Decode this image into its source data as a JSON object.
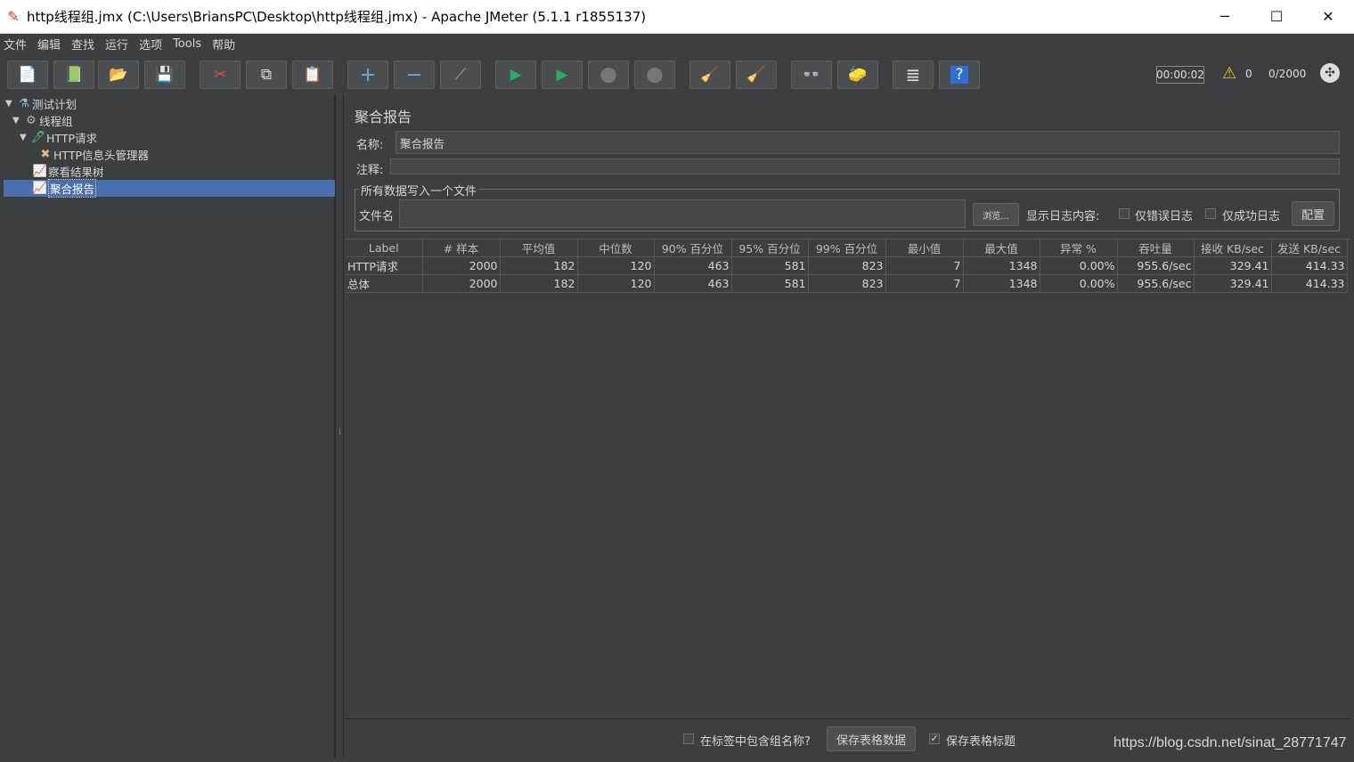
{
  "window": {
    "title": "http线程组.jmx (C:\\Users\\BriansPC\\Desktop\\http线程组.jmx) - Apache JMeter (5.1.1 r1855137)",
    "minimize": "─",
    "maximize": "☐",
    "close": "✕"
  },
  "menu": [
    "文件",
    "编辑",
    "查找",
    "运行",
    "选项",
    "Tools",
    "帮助"
  ],
  "toolbar": {
    "icons": [
      "new-icon",
      "templates-icon",
      "open-icon",
      "save-icon",
      "cut-icon",
      "copy-icon",
      "paste-icon",
      "expand-icon",
      "collapse-icon",
      "toggle-icon",
      "start-icon",
      "start-no-pause-icon",
      "stop-icon",
      "shutdown-icon",
      "clear-icon",
      "clear-all-icon",
      "search-icon",
      "reset-search-icon",
      "function-helper-icon",
      "help-icon"
    ],
    "glyphs": [
      "📄",
      "📗",
      "📂",
      "💾",
      "✂",
      "⧉",
      "📋",
      "+",
      "−",
      "⟋",
      "▶",
      "▶",
      "⬤",
      "⬤",
      "🧹",
      "🧹",
      "👓",
      "🧽",
      "≣",
      "?"
    ],
    "timer": "00:00:02",
    "warnings": "0",
    "threads": "0/2000"
  },
  "tree": [
    {
      "label": "测试计划",
      "icon": "⚗",
      "level": 0,
      "expanded": true
    },
    {
      "label": "线程组",
      "icon": "⚙",
      "level": 1,
      "expanded": true
    },
    {
      "label": "HTTP请求",
      "icon": "🖊",
      "level": 2,
      "expanded": true
    },
    {
      "label": "HTTP信息头管理器",
      "icon": "✖",
      "level": 3
    },
    {
      "label": "察看结果树",
      "icon": "📈",
      "level": 3
    },
    {
      "label": "聚合报告",
      "icon": "📈",
      "level": 3,
      "selected": true
    }
  ],
  "panel": {
    "title": "聚合报告",
    "name_label": "名称:",
    "name_value": "聚合报告",
    "comment_label": "注释:",
    "comment_value": "",
    "file_group_title": "所有数据写入一个文件",
    "file_label": "文件名",
    "file_value": "",
    "browse_button": "浏览...",
    "log_display_label": "显示日志内容:",
    "errors_only": "仅错误日志",
    "success_only": "仅成功日志",
    "configure_button": "配置"
  },
  "table": {
    "columns": [
      "Label",
      "# 样本",
      "平均值",
      "中位数",
      "90% 百分位",
      "95% 百分位",
      "99% 百分位",
      "最小值",
      "最大值",
      "异常 %",
      "吞吐量",
      "接收 KB/sec",
      "发送 KB/sec"
    ],
    "rows": [
      [
        "HTTP请求",
        "2000",
        "182",
        "120",
        "463",
        "581",
        "823",
        "7",
        "1348",
        "0.00%",
        "955.6/sec",
        "329.41",
        "414.33"
      ],
      [
        "总体",
        "2000",
        "182",
        "120",
        "463",
        "581",
        "823",
        "7",
        "1348",
        "0.00%",
        "955.6/sec",
        "329.41",
        "414.33"
      ]
    ]
  },
  "bottom": {
    "include_group_name": "在标签中包含组名称?",
    "include_group_checked": false,
    "save_table_data": "保存表格数据",
    "save_table_header": "保存表格标题",
    "save_header_checked": true
  },
  "watermark": "https://blog.csdn.net/sinat_28771747"
}
